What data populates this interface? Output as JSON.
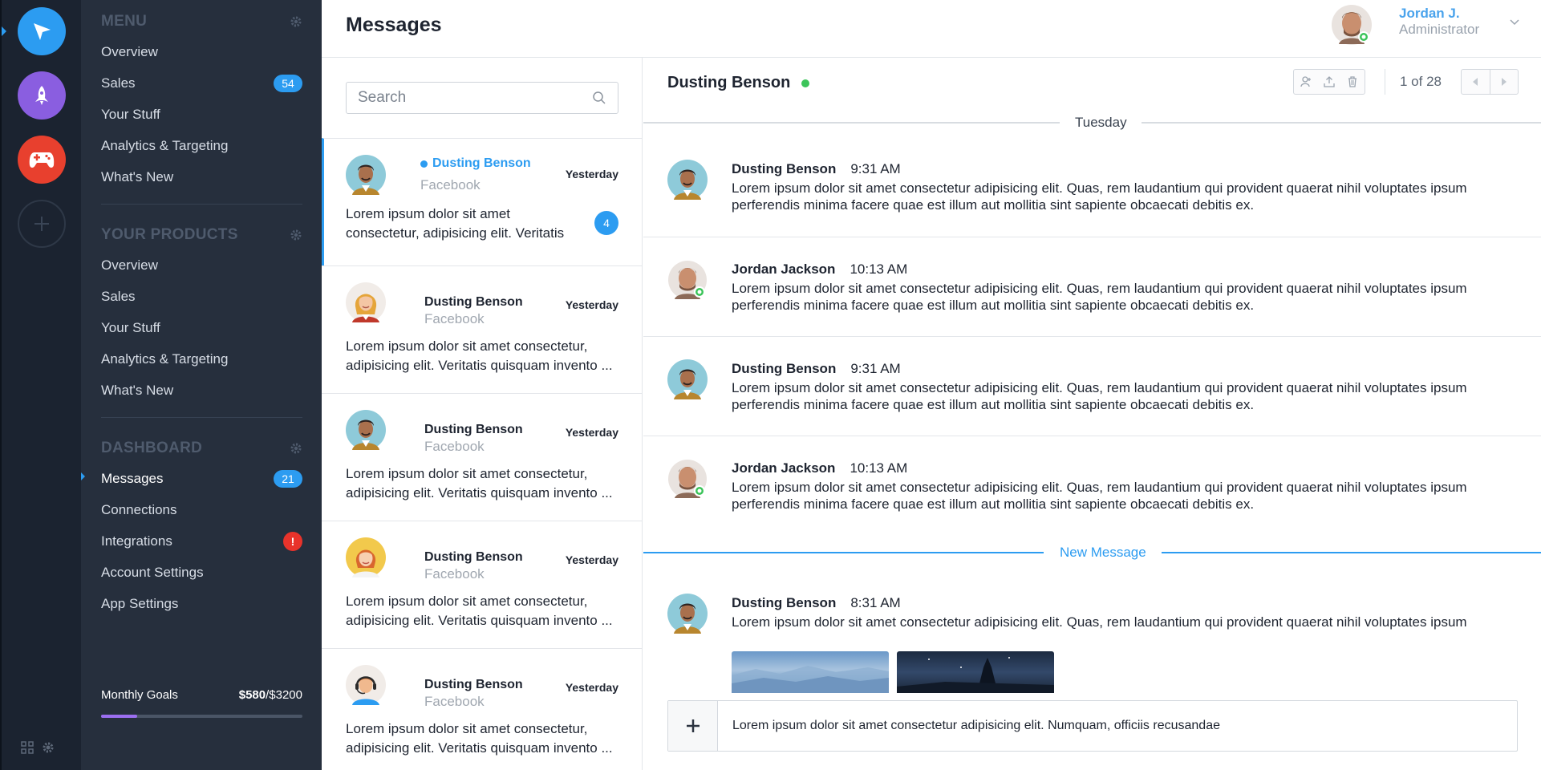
{
  "rail": {
    "apps": [
      {
        "name": "cursor-app",
        "color": "#2c9cf1"
      },
      {
        "name": "rocket-app",
        "color": "#8a5ee0"
      },
      {
        "name": "gamepad-app",
        "color": "#e8402e"
      },
      {
        "name": "add-app",
        "color": "#2e3847"
      }
    ]
  },
  "nav": {
    "menu_title": "MENU",
    "menu_items": [
      {
        "label": "Overview"
      },
      {
        "label": "Sales",
        "badge": "54"
      },
      {
        "label": "Your Stuff"
      },
      {
        "label": "Analytics & Targeting"
      },
      {
        "label": "What's New"
      }
    ],
    "products_title": "YOUR PRODUCTS",
    "products_items": [
      {
        "label": "Overview"
      },
      {
        "label": "Sales"
      },
      {
        "label": "Your Stuff"
      },
      {
        "label": "Analytics & Targeting"
      },
      {
        "label": "What's New"
      }
    ],
    "dashboard_title": "DASHBOARD",
    "dashboard_items": [
      {
        "label": "Messages",
        "badge": "21",
        "active": true
      },
      {
        "label": "Connections"
      },
      {
        "label": "Integrations",
        "alert": "!"
      },
      {
        "label": "Account Settings"
      },
      {
        "label": "App Settings"
      }
    ],
    "goals": {
      "label": "Monthly Goals",
      "current": "$580",
      "total": "/$3200",
      "progress": 0.18
    }
  },
  "header": {
    "title": "Messages",
    "user_name": "Jordan J.",
    "user_role": "Administrator"
  },
  "list": {
    "search_placeholder": "Search",
    "threads": [
      {
        "name": "Dusting Benson",
        "source": "Facebook",
        "when": "Yesterday",
        "preview": "Lorem ipsum dolor sit amet consectetur, adipisicing elit. Veritatis quisquam invento...",
        "count": "4",
        "avatar": "man-teal"
      },
      {
        "name": "Dusting Benson",
        "source": "Facebook",
        "when": "Yesterday",
        "preview": "Lorem ipsum dolor sit amet consectetur, adipisicing elit. Veritatis quisquam invento ...",
        "avatar": "woman-blonde"
      },
      {
        "name": "Dusting Benson",
        "source": "Facebook",
        "when": "Yesterday",
        "preview": "Lorem ipsum dolor sit amet consectetur, adipisicing elit. Veritatis quisquam invento ...",
        "avatar": "man-teal"
      },
      {
        "name": "Dusting Benson",
        "source": "Facebook",
        "when": "Yesterday",
        "preview": "Lorem ipsum dolor sit amet consectetur, adipisicing elit. Veritatis quisquam invento ...",
        "avatar": "woman-yellow"
      },
      {
        "name": "Dusting Benson",
        "source": "Facebook",
        "when": "Yesterday",
        "preview": "Lorem ipsum dolor sit amet consectetur, adipisicing elit. Veritatis quisquam invento ...",
        "avatar": "man-headset"
      }
    ]
  },
  "conversation": {
    "contact": "Dusting Benson",
    "pager": "1 of 28",
    "day_label": "Tuesday",
    "new_label": "New Message",
    "messages": [
      {
        "author": "Dusting Benson",
        "time": "9:31 AM",
        "text": "Lorem ipsum dolor sit amet consectetur adipisicing elit. Quas, rem laudantium qui provident quaerat nihil voluptates ipsum perferendis minima facere quae est illum aut mollitia sint sapiente obcaecati debitis ex."
      },
      {
        "author": "Jordan Jackson",
        "time": "10:13 AM",
        "text": "Lorem ipsum dolor sit amet consectetur adipisicing elit. Quas, rem laudantium qui provident quaerat nihil voluptates ipsum perferendis minima facere quae est illum aut mollitia sint sapiente obcaecati debitis ex."
      },
      {
        "author": "Dusting Benson",
        "time": "9:31 AM",
        "text": "Lorem ipsum dolor sit amet consectetur adipisicing elit. Quas, rem laudantium qui provident quaerat nihil voluptates ipsum perferendis minima facere quae est illum aut mollitia sint sapiente obcaecati debitis ex."
      },
      {
        "author": "Jordan Jackson",
        "time": "10:13 AM",
        "text": "Lorem ipsum dolor sit amet consectetur adipisicing elit. Quas, rem laudantium qui provident quaerat nihil voluptates ipsum perferendis minima facere quae est illum aut mollitia sint sapiente obcaecati debitis ex."
      }
    ],
    "new_message": {
      "author": "Dusting Benson",
      "time": "8:31 AM",
      "text": "Lorem ipsum dolor sit amet consectetur adipisicing elit. Quas, rem laudantium qui provident quaerat nihil voluptates ipsum"
    },
    "composer_value": "Lorem ipsum dolor sit amet consectetur adipisicing elit. Numquam, officiis recusandae"
  }
}
